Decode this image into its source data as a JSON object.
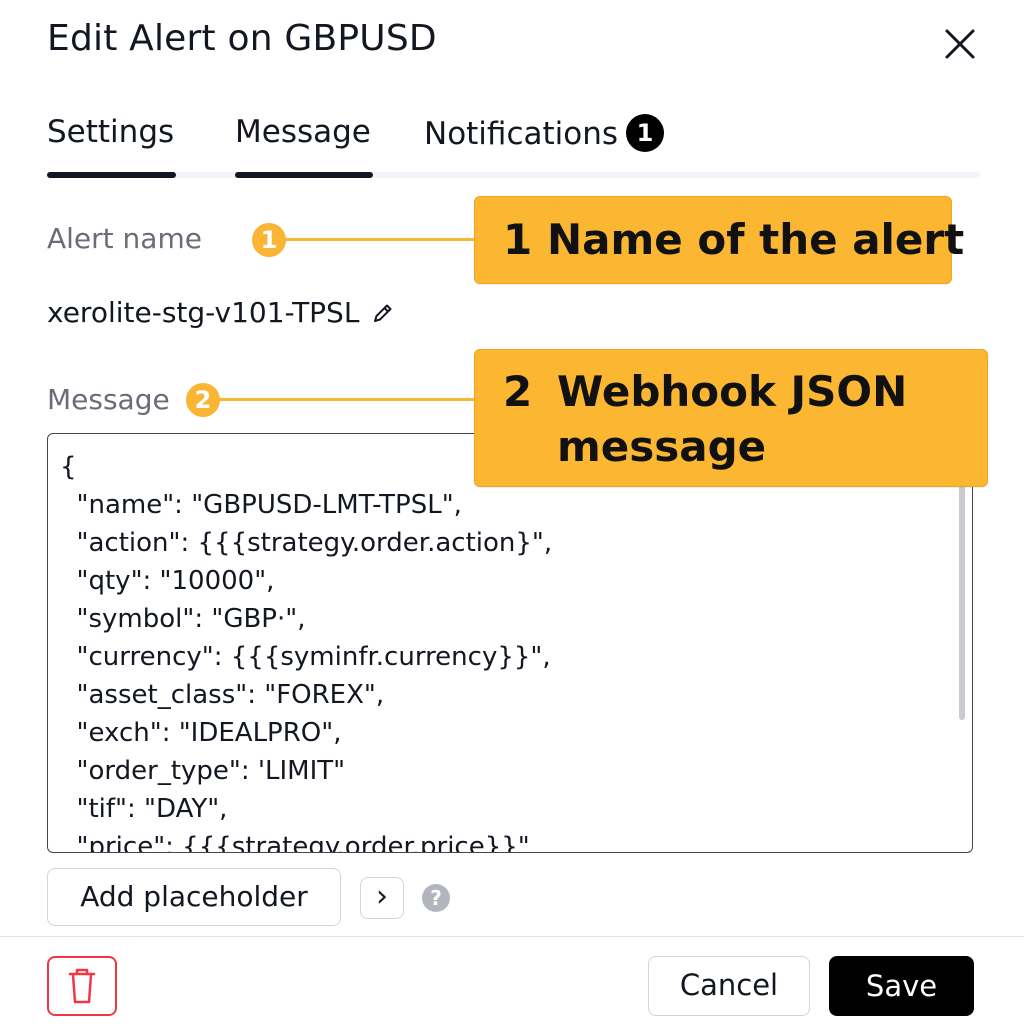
{
  "dialog": {
    "title": "Edit Alert on GBPUSD"
  },
  "tabs": [
    {
      "label": "Settings",
      "active": true
    },
    {
      "label": "Message",
      "active": true
    },
    {
      "label": "Notifications",
      "badge": "1"
    }
  ],
  "alert_name": {
    "label": "Alert name",
    "value": "xerolite-stg-v101-TPSL",
    "step": "1"
  },
  "message": {
    "label": "Message",
    "step": "2",
    "lines": [
      "{",
      "  \"name\": \"GBPUSD-LMT-TPSL\",",
      "  \"action\": {{{strategy.order.action}\",",
      "  \"qty\": \"10000\",",
      "  \"symbol\": \"GBP·\",",
      "  \"currency\": {{{syminfr.currency}}\",",
      "  \"asset_class\": \"FOREX\",",
      "  \"exch\": \"IDEALPRO\",",
      "  \"order_type\": 'LIMIT\"",
      "  \"tif\": \"DAY\",",
      "  \"price\": {{{strategy.order.price}}\""
    ]
  },
  "callouts": [
    {
      "num": "1",
      "text_lines": [
        "Name of the alert"
      ]
    },
    {
      "num": "2",
      "text_lines": [
        "Webhook JSON",
        "message"
      ]
    }
  ],
  "toolbar": {
    "add_placeholder_label": "Add placeholder",
    "more_glyph": "›",
    "help_glyph": "?"
  },
  "footer": {
    "cancel_label": "Cancel",
    "save_label": "Save"
  },
  "colors": {
    "accent": "#fbb732",
    "danger": "#f23645",
    "primary": "#000000"
  },
  "icons": [
    "close-icon",
    "pencil-icon",
    "chevron-right-icon",
    "help-icon",
    "trash-icon"
  ]
}
